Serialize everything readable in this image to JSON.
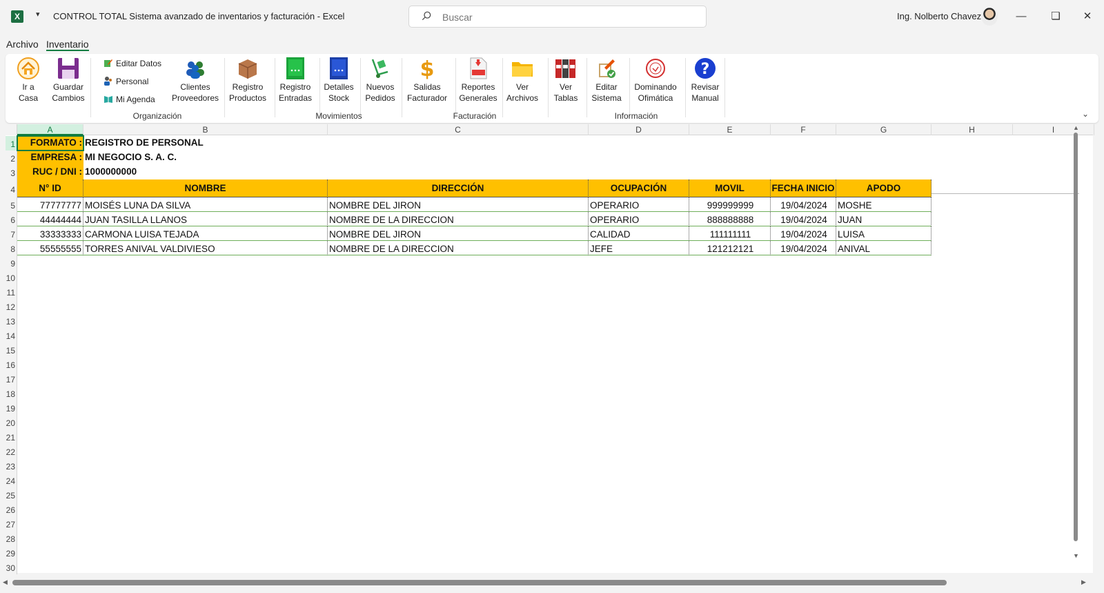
{
  "window": {
    "title": "CONTROL TOTAL Sistema avanzado de inventarios y facturación  -  Excel",
    "search_placeholder": "Buscar",
    "user": "Ing. Nolberto Chavez",
    "app_icon": "X"
  },
  "menu": {
    "tabs": [
      "Archivo",
      "Inventario"
    ],
    "active": "Inventario"
  },
  "ribbon": {
    "buttons": {
      "ir_casa": "Ir a\nCasa",
      "guardar": "Guardar\nCambios",
      "editar_datos": "Editar Datos",
      "personal": "Personal",
      "mi_agenda": "Mi Agenda",
      "clientes": "Clientes\nProveedores",
      "registro_productos": "Registro\nProductos",
      "registro_entradas": "Registro\nEntradas",
      "detalles_stock": "Detalles\nStock",
      "nuevos_pedidos": "Nuevos\nPedidos",
      "salidas": "Salidas\nFacturador",
      "reportes": "Reportes\nGenerales",
      "ver_archivos": "Ver\nArchivos",
      "ver_tablas": "Ver\nTablas",
      "editar_sistema": "Editar\nSistema",
      "dominando": "Dominando\nOfimática",
      "revisar": "Revisar\nManual"
    },
    "groups": {
      "organizacion": "Organización",
      "movimientos": "Movimientos",
      "facturacion": "Facturación",
      "informacion": "Información"
    }
  },
  "sheet": {
    "columns": [
      "A",
      "B",
      "C",
      "D",
      "E",
      "F",
      "G",
      "H",
      "I"
    ],
    "rows": [
      "1",
      "2",
      "3",
      "4",
      "5",
      "6",
      "7",
      "8",
      "9",
      "10",
      "11",
      "12",
      "13",
      "14",
      "15",
      "16",
      "17",
      "18",
      "19",
      "20",
      "21",
      "22",
      "23",
      "24",
      "25",
      "26",
      "27",
      "28",
      "29",
      "30"
    ],
    "info": {
      "formato_label": "FORMATO :",
      "formato_value": "REGISTRO DE PERSONAL",
      "empresa_label": "EMPRESA :",
      "empresa_value": "MI NEGOCIO S. A. C.",
      "ruc_label": "RUC / DNI :",
      "ruc_value": "1000000000"
    },
    "table": {
      "headers": [
        "N° ID",
        "NOMBRE",
        "DIRECCIÓN",
        "OCUPACIÓN",
        "MOVIL",
        "FECHA INICIO",
        "APODO"
      ],
      "rows": [
        [
          "77777777",
          "MOISÉS LUNA DA SILVA",
          "NOMBRE DEL JIRON",
          "OPERARIO",
          "999999999",
          "19/04/2024",
          "MOSHE"
        ],
        [
          "44444444",
          "JUAN TASILLA LLANOS",
          "NOMBRE DE LA DIRECCION",
          "OPERARIO",
          "888888888",
          "19/04/2024",
          "JUAN"
        ],
        [
          "33333333",
          "CARMONA LUISA TEJADA",
          "NOMBRE DEL JIRON",
          "CALIDAD",
          "111111111",
          "19/04/2024",
          "LUISA"
        ],
        [
          "55555555",
          "TORRES ANIVAL VALDIVIESO",
          "NOMBRE DE LA DIRECCION",
          "JEFE",
          "121212121",
          "19/04/2024",
          "ANIVAL"
        ]
      ]
    }
  },
  "colors": {
    "header_fill": "#ffc000",
    "excel_green": "#107c41",
    "table_border": "#6fae5a"
  }
}
